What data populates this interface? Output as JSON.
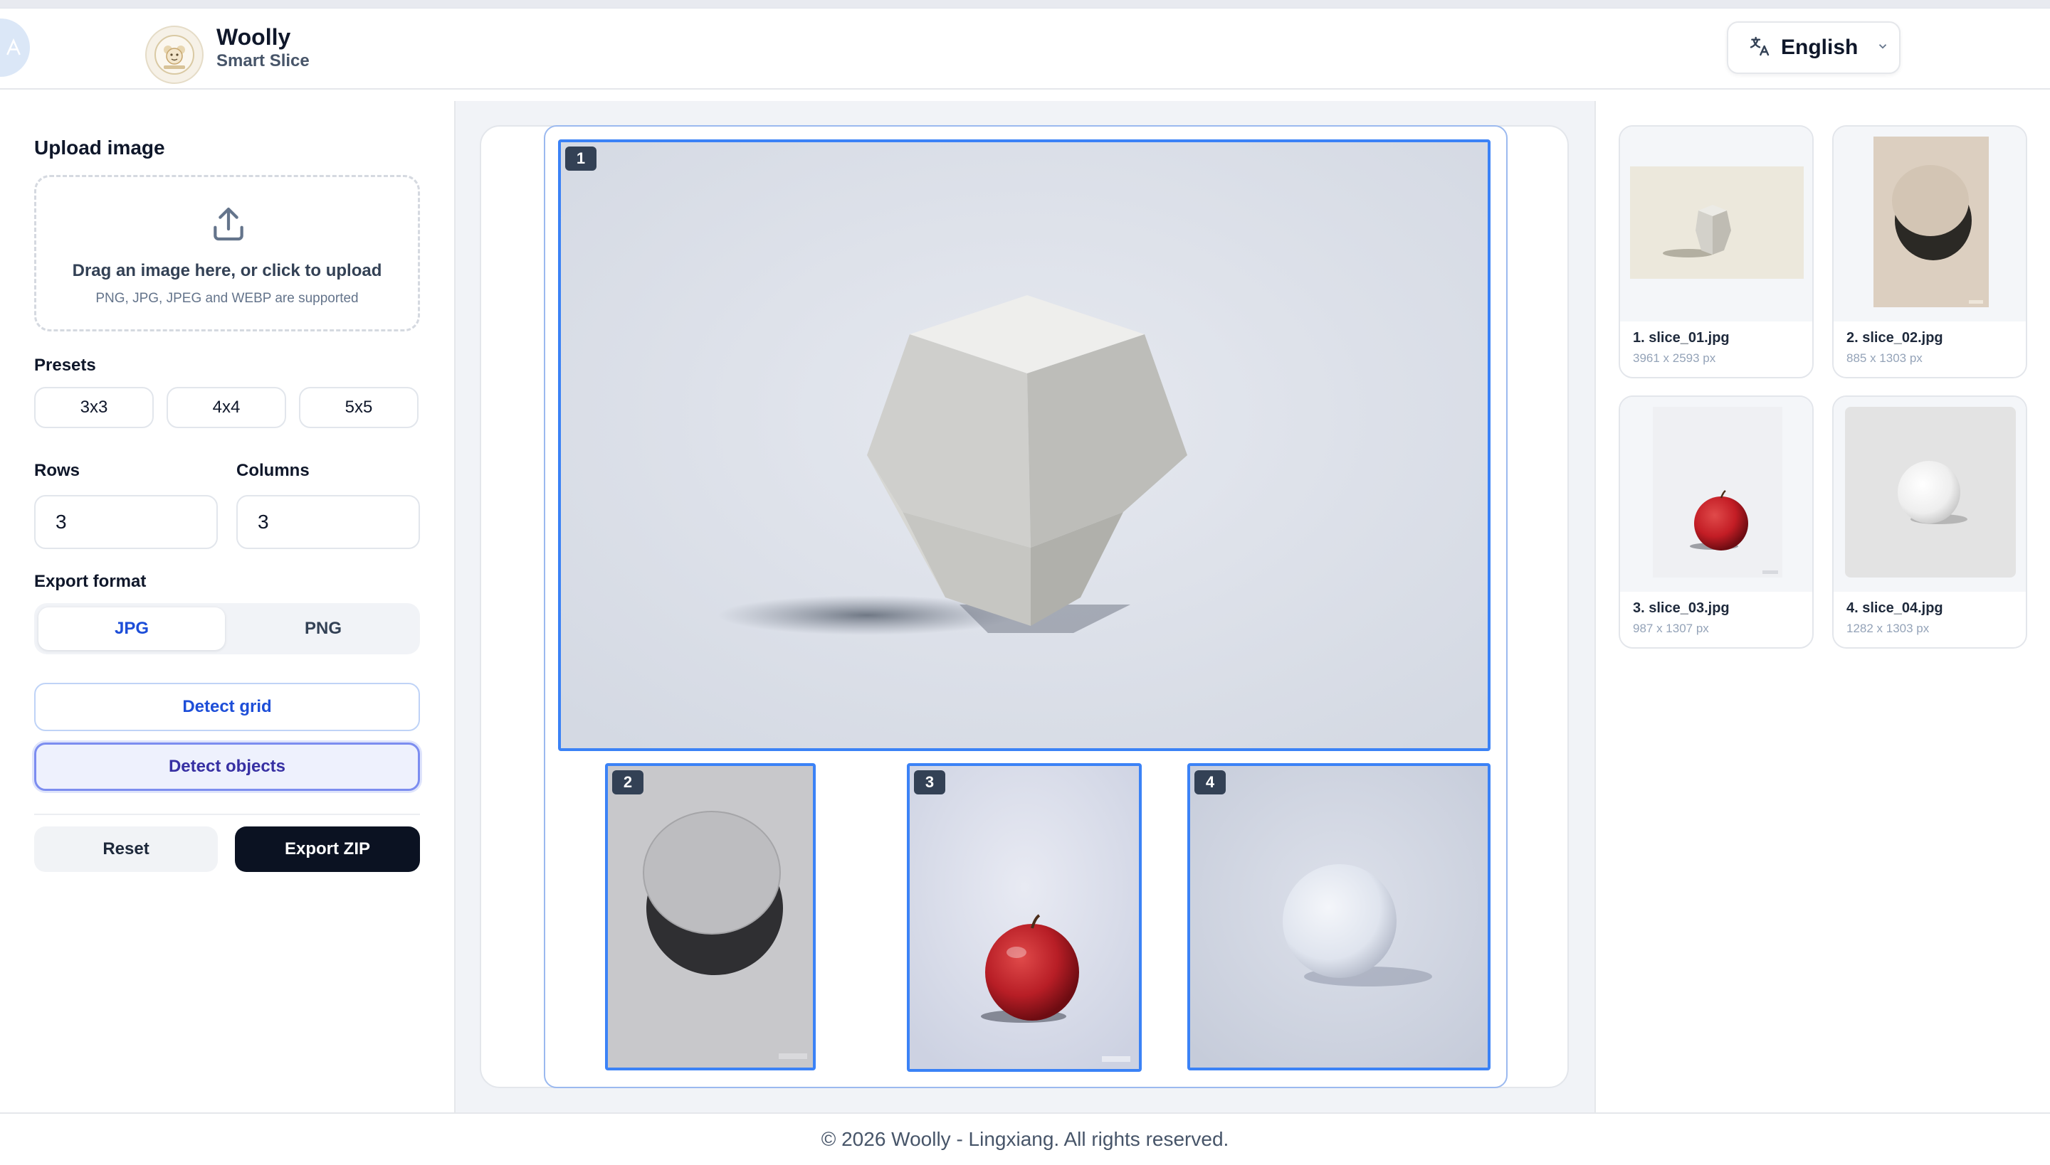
{
  "header": {
    "brand_name": "Woolly",
    "brand_sub": "Smart Slice",
    "language": "English"
  },
  "sidebar": {
    "upload_label": "Upload image",
    "upload_title": "Drag an image here, or click to upload",
    "upload_sub": "PNG, JPG, JPEG and WEBP are supported",
    "presets_label": "Presets",
    "presets": [
      "3x3",
      "4x4",
      "5x5"
    ],
    "rows_label": "Rows",
    "rows_value": "3",
    "columns_label": "Columns",
    "columns_value": "3",
    "export_format_label": "Export format",
    "formats": [
      "JPG",
      "PNG"
    ],
    "selected_format": "JPG",
    "detect_grid": "Detect grid",
    "detect_objects": "Detect objects",
    "reset": "Reset",
    "export_zip": "Export ZIP"
  },
  "slices": [
    {
      "num": "1"
    },
    {
      "num": "2"
    },
    {
      "num": "3"
    },
    {
      "num": "4"
    }
  ],
  "thumbnails": [
    {
      "name": "1. slice_01.jpg",
      "size": "3961 x 2593 px"
    },
    {
      "name": "2. slice_02.jpg",
      "size": "885 x 1303 px"
    },
    {
      "name": "3. slice_03.jpg",
      "size": "987 x 1307 px"
    },
    {
      "name": "4. slice_04.jpg",
      "size": "1282 x 1303 px"
    }
  ],
  "footer": "© 2026 Woolly - Lingxiang. All rights reserved.",
  "colors": {
    "accent": "#3b82f6",
    "primary_dark": "#0b1222",
    "link_blue": "#1d4ed8"
  }
}
